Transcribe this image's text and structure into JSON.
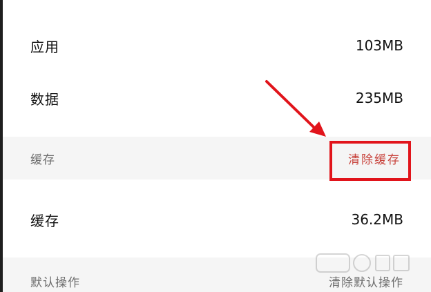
{
  "storage": {
    "rows": [
      {
        "label": "应用",
        "value": "103MB"
      },
      {
        "label": "数据",
        "value": "235MB"
      }
    ]
  },
  "cache_section": {
    "header": "缓存",
    "action": "清除缓存",
    "row": {
      "label": "缓存",
      "value": "36.2MB"
    }
  },
  "defaults_section": {
    "header": "默认操作",
    "action": "清除默认操作"
  },
  "annotation": {
    "color": "#e1141b"
  }
}
